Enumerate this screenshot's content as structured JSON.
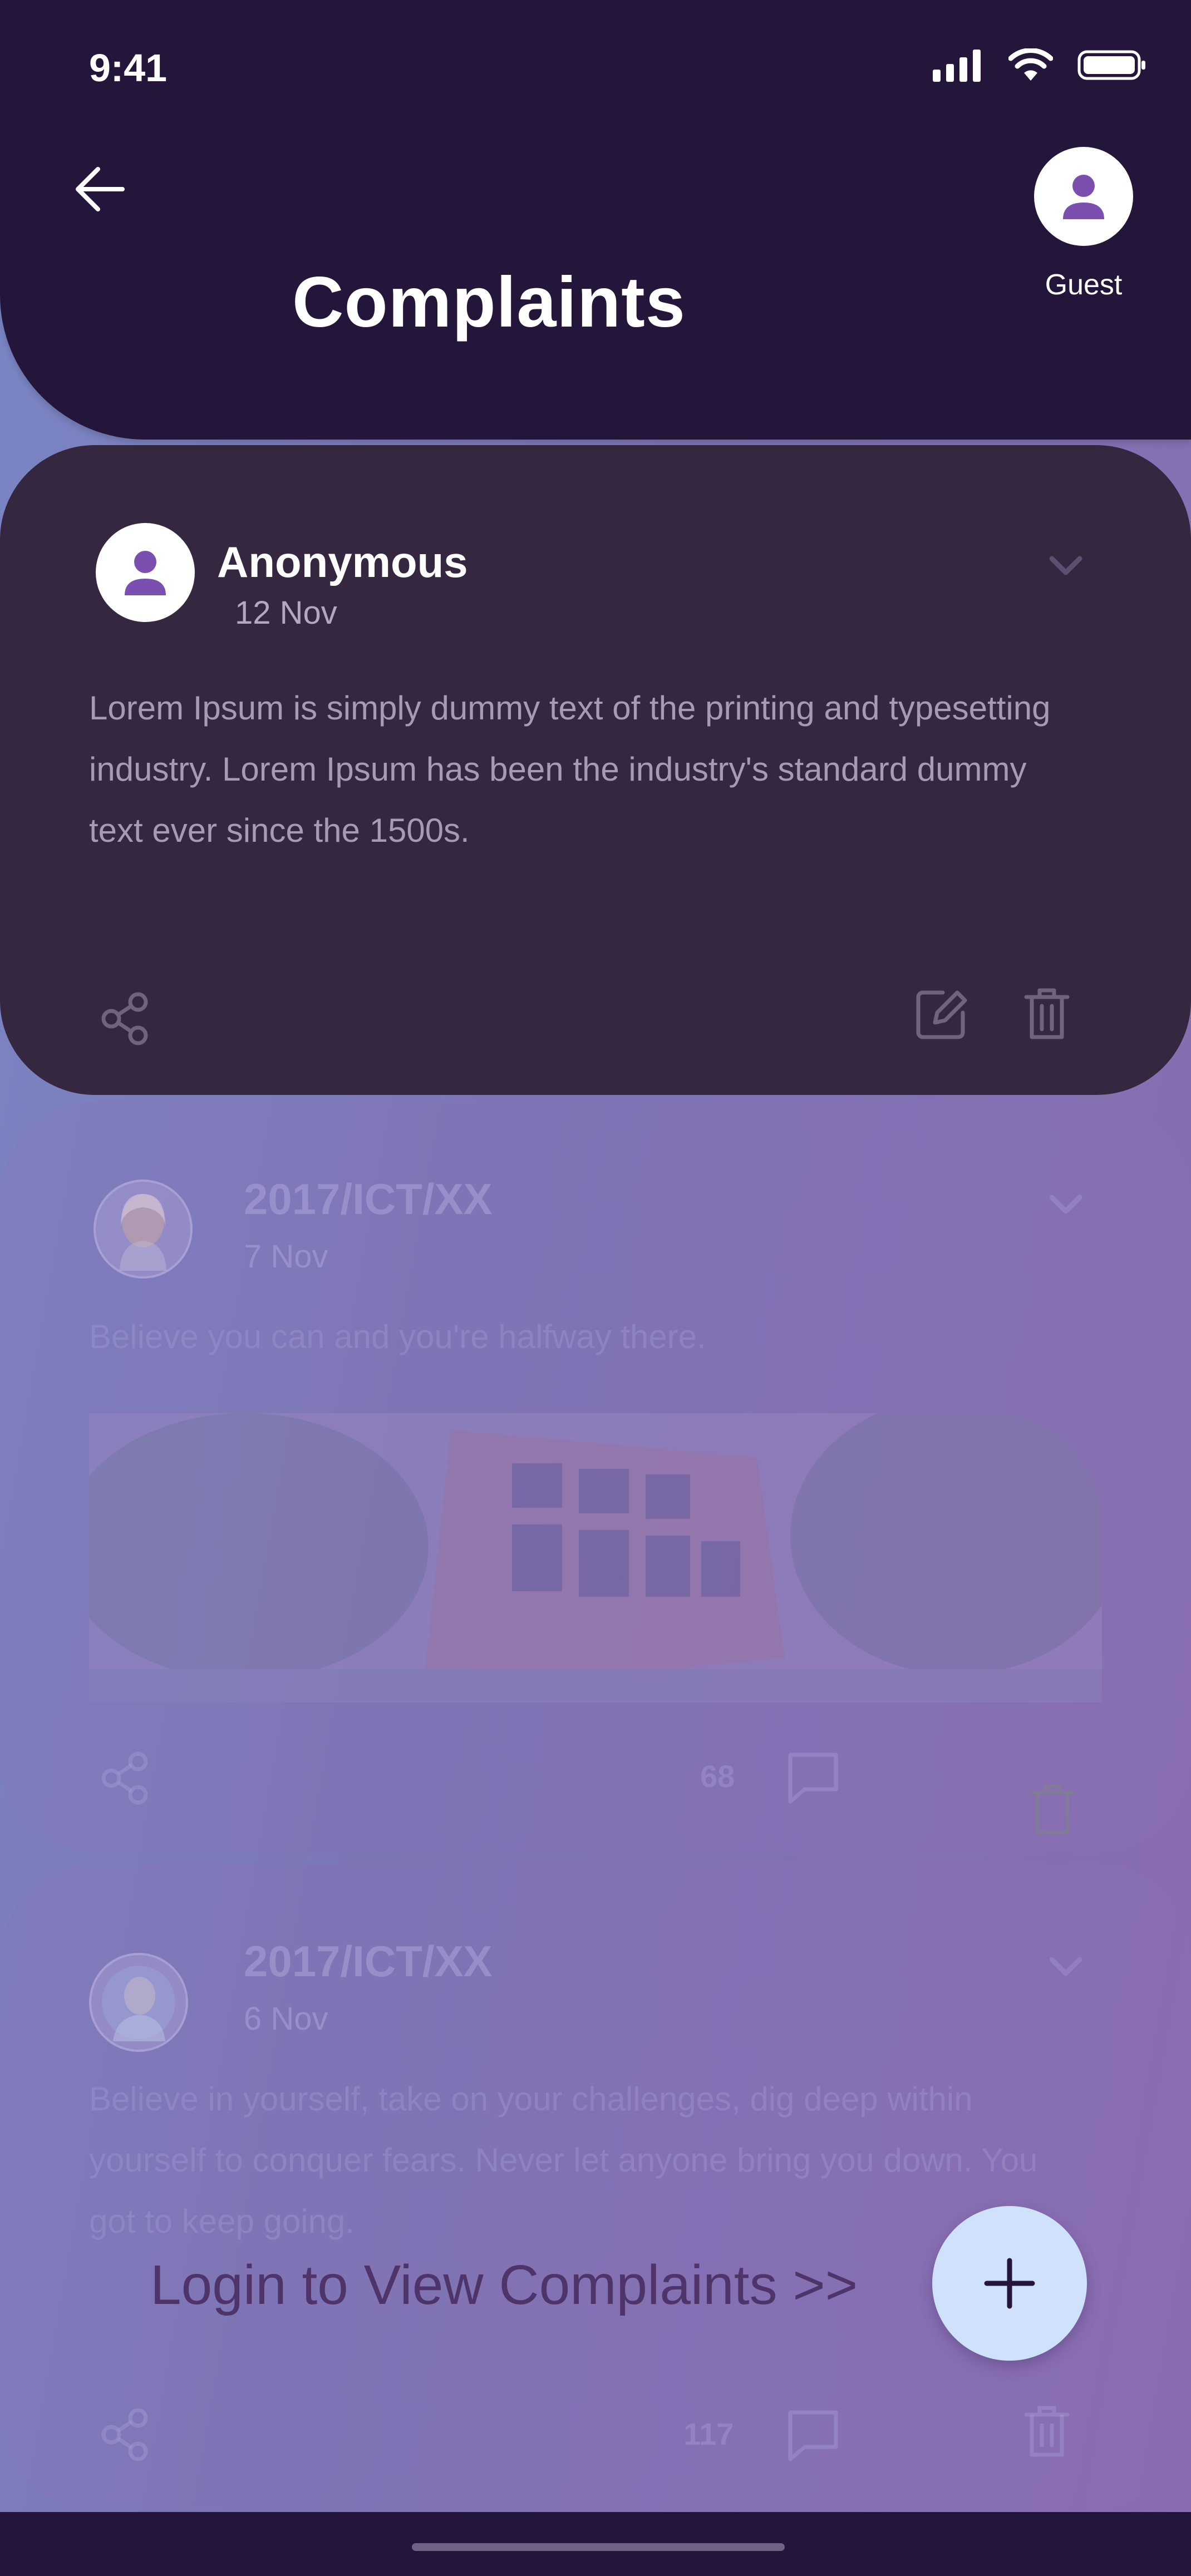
{
  "status_bar": {
    "time": "9:41"
  },
  "header": {
    "title": "Complaints",
    "user_label": "Guest"
  },
  "complaints": [
    {
      "author": "Anonymous",
      "date": "12 Nov",
      "text": "Lorem Ipsum is simply dummy text of the printing and typesetting industry. Lorem Ipsum has been the industry's standard dummy text ever since the 1500s."
    },
    {
      "author": "2017/ICT/XX",
      "date": "7 Nov",
      "text": "Believe you can and you're halfway there.",
      "comment_count": "68"
    },
    {
      "author": "2017/ICT/XX",
      "date": "6 Nov",
      "text": "Believe in yourself, take on your challenges, dig deep within yourself to conquer fears. Never let anyone bring you down. You got to keep going.",
      "comment_count": "117"
    }
  ],
  "cta": {
    "login_text": "Login to View Complaints >>"
  },
  "colors": {
    "header_bg": "#24163a",
    "card_bg": "#352740",
    "fab_bg": "#cfe1fb",
    "accent_purple": "#7b4fb0"
  },
  "icons": [
    "back-arrow-icon",
    "person-icon",
    "chevron-down-icon",
    "share-icon",
    "edit-icon",
    "trash-icon",
    "comment-icon",
    "plus-icon"
  ]
}
